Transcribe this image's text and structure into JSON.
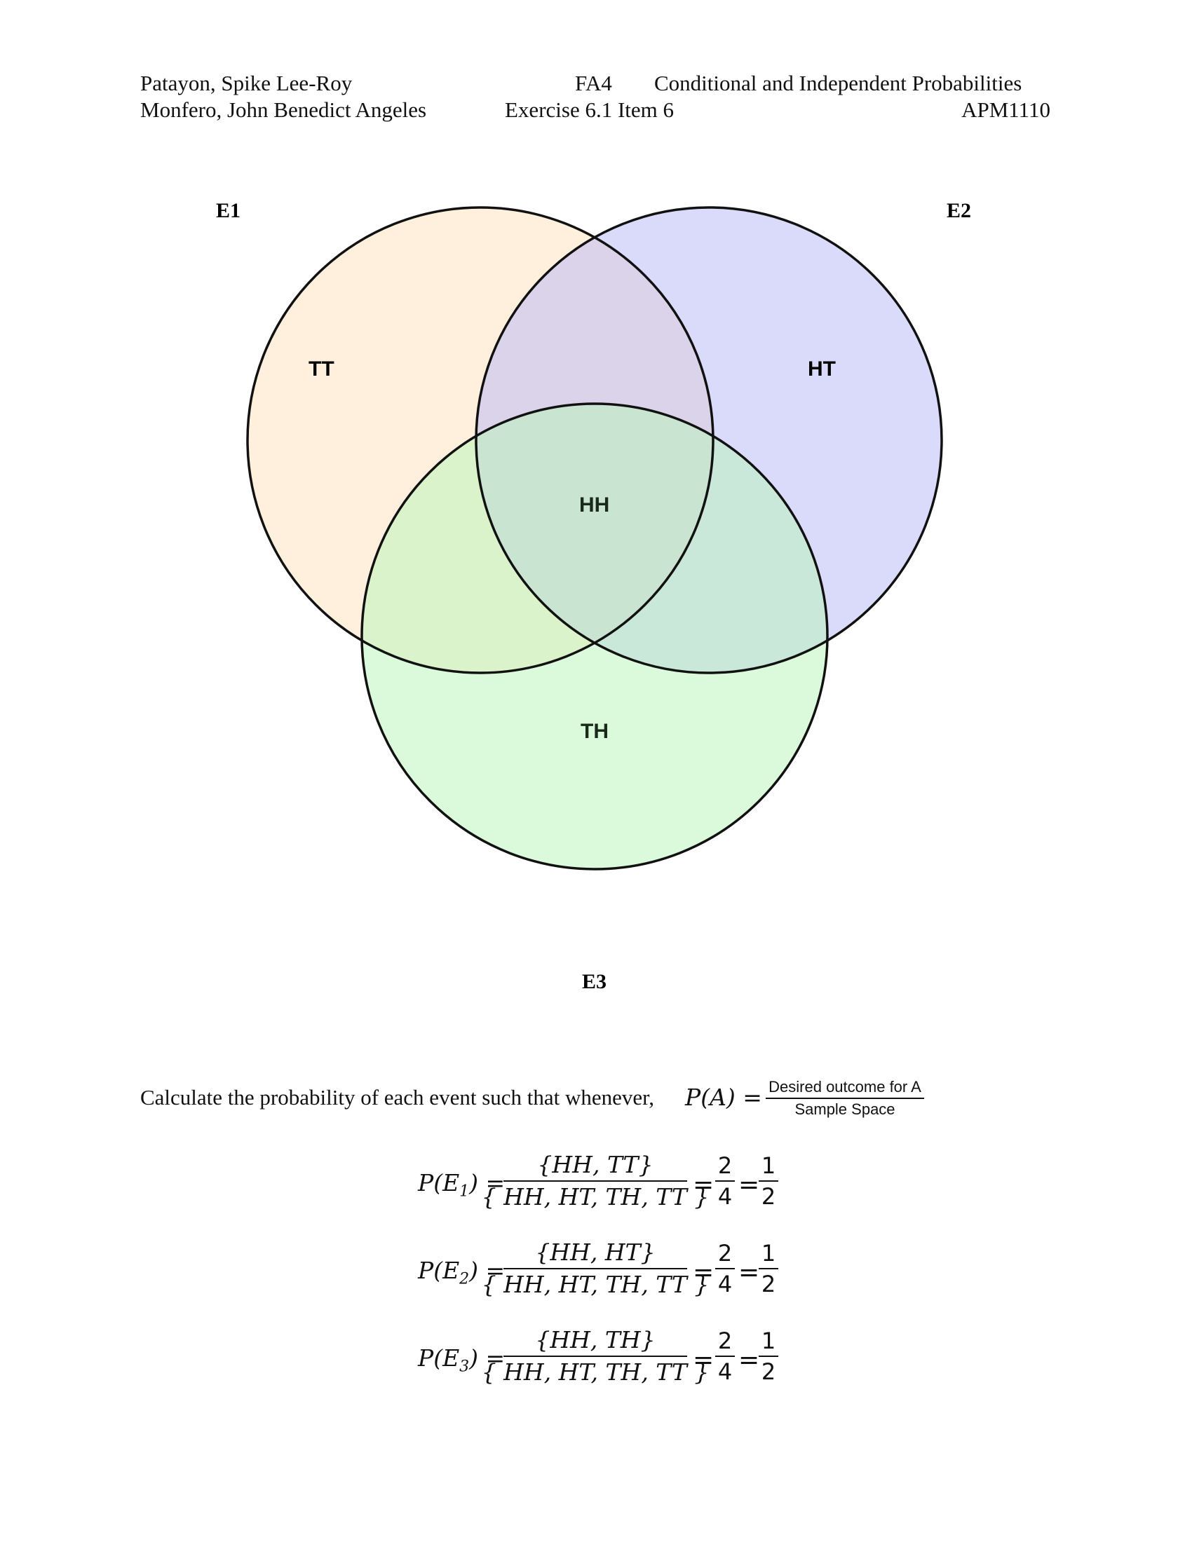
{
  "header": {
    "left_line1": "Patayon, Spike Lee-Roy",
    "left_line2": "Monfero, John Benedict Angeles",
    "mid_line1": "FA4",
    "mid_line2": "Exercise 6.1 Item 6",
    "right_line1": "Conditional and Independent Probabilities",
    "right_line2": "APM1110"
  },
  "venn": {
    "set_labels": [
      "E1",
      "E2",
      "E3"
    ],
    "regions": {
      "e1_only": "TT",
      "e2_only": "HT",
      "all": "HH",
      "e3_only": "TH"
    },
    "colors": {
      "e1": "#fde3bf",
      "e2": "#b5b5f7",
      "e3": "#b8f5b8",
      "stroke": "#111111"
    }
  },
  "intro": {
    "text": "Calculate the probability of each event such that whenever,",
    "formula_lhs": "P(A) =",
    "formula_num": "Desired outcome for A",
    "formula_den": "Sample Space"
  },
  "equations": [
    {
      "lhs_p": "P(E",
      "sub": "1",
      "lhs_close": ") =",
      "num": "{HH, TT}",
      "den": "{ HH, HT, TH, TT }",
      "eq1": "=",
      "f1_num": "2",
      "f1_den": "4",
      "eq2": "=",
      "f2_num": "1",
      "f2_den": "2"
    },
    {
      "lhs_p": "P(E",
      "sub": "2",
      "lhs_close": ") =",
      "num": "{HH, HT}",
      "den": "{ HH, HT, TH, TT }",
      "eq1": "=",
      "f1_num": "2",
      "f1_den": "4",
      "eq2": "=",
      "f2_num": "1",
      "f2_den": "2"
    },
    {
      "lhs_p": "P(E",
      "sub": "3",
      "lhs_close": ") =",
      "num": "{HH, TH}",
      "den": "{ HH, HT, TH, TT }",
      "eq1": "=",
      "f1_num": "2",
      "f1_den": "4",
      "eq2": "=",
      "f2_num": "1",
      "f2_den": "2"
    }
  ]
}
